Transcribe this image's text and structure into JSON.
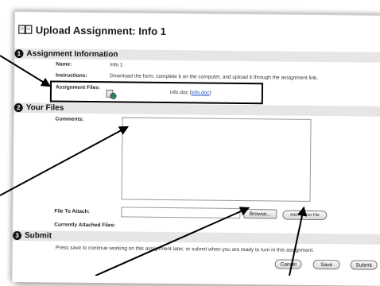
{
  "page": {
    "title": "Upload Assignment: Info 1"
  },
  "sections": {
    "assignment_information": {
      "number": "1",
      "title": "Assignment Information"
    },
    "your_files": {
      "number": "2",
      "title": "Your Files"
    },
    "submit": {
      "number": "3",
      "title": "Submit"
    }
  },
  "info": {
    "name_label": "Name:",
    "name_value": "Info 1",
    "instructions_label": "Instructions:",
    "instructions_value": "Download the form, complete it on the computer, and upload it through the assignment link.",
    "files_label": "Assignment Files:",
    "file_name": "info.doc",
    "file_link": "info.doc",
    "file_link_open": "(",
    "file_link_close": ")"
  },
  "files": {
    "comments_label": "Comments:",
    "comments_value": "",
    "file_to_attach_label": "File To Attach:",
    "file_to_attach_value": "",
    "browse_label": "Browse...",
    "add_another_file_label": "Add Another File",
    "currently_attached_label": "Currently Attached Files:"
  },
  "submit": {
    "note": "Press save to continue working on this assignment later, or submit when you are ready to turn in this assignment.",
    "cancel_label": "Cancel",
    "save_label": "Save",
    "submit_label": "Submit"
  },
  "icons": {
    "title_icon": "book-icon",
    "attachment_icon": "document-attachment-icon"
  }
}
